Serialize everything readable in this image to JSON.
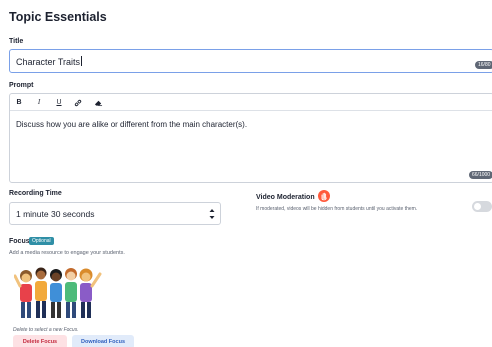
{
  "page": {
    "title": "Topic Essentials"
  },
  "title_field": {
    "label": "Title",
    "value": "Character Traits",
    "counter": "16/80"
  },
  "prompt_field": {
    "label": "Prompt",
    "toolbar": [
      {
        "label": "B",
        "name": "bold-button"
      },
      {
        "label": "I",
        "name": "italic-button"
      },
      {
        "label": "U",
        "name": "underline-button"
      },
      {
        "label": "🔗",
        "name": "link-button",
        "icon": "link-icon"
      },
      {
        "label": "⌫",
        "name": "clear-format-button",
        "icon": "eraser-icon"
      }
    ],
    "value": "Discuss how you are alike or different from the main character(s).",
    "counter": "66/1000"
  },
  "recording_time": {
    "label": "Recording Time",
    "selected": "1 minute 30 seconds"
  },
  "video_moderation": {
    "title": "Video Moderation",
    "description": "If moderated, videos will be hidden from students until you activate them.",
    "enabled": false,
    "icon": "hand-icon",
    "icon_color": "#ff5a3c"
  },
  "focus": {
    "label": "Focus",
    "badge": "Optional",
    "help": "Add a media resource to engage your students.",
    "image_desc": "group-of-kids-illustration",
    "delete_note": "Delete to select a new Focus.",
    "delete_label": "Delete Focus",
    "download_label": "Download Focus"
  },
  "colors": {
    "accent": "#7aa0e8",
    "badge": "#2f8fa6",
    "delete_bg": "#fde1e4",
    "delete_text": "#c3283d",
    "download_bg": "#e1ebfa",
    "download_text": "#2f5fbf"
  }
}
